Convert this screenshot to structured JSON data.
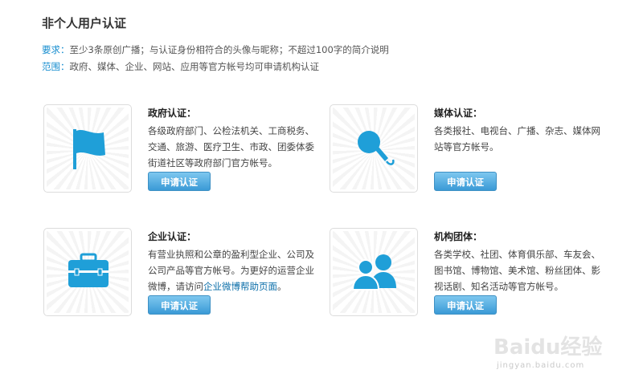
{
  "page": {
    "title": "非个人用户认证"
  },
  "requirements": {
    "req_label": "要求：",
    "req_text": "至少3条原创广播；与认证身份相符合的头像与昵称；不超过100字的简介说明",
    "scope_label": "范围：",
    "scope_text": "政府、媒体、企业、网站、应用等官方帐号均可申请机构认证"
  },
  "cards": {
    "gov": {
      "icon": "flag-icon",
      "title": "政府认证：",
      "desc": "各级政府部门、公检法机关、工商税务、交通、旅游、医疗卫生、市政、团委体委街道社区等政府部门官方帐号。",
      "button": "申请认证"
    },
    "media": {
      "icon": "microphone-icon",
      "title": "媒体认证：",
      "desc": "各类报社、电视台、广播、杂志、媒体网站等官方帐号。",
      "button": "申请认证"
    },
    "enterprise": {
      "icon": "briefcase-icon",
      "title": "企业认证：",
      "desc_pre": "有营业执照和公章的盈利型企业、公司及公司产品等官方帐号。为更好的运营企业微博，请访问",
      "desc_link": "企业微博帮助页面",
      "desc_post": "。",
      "button": "申请认证"
    },
    "org": {
      "icon": "group-icon",
      "title": "机构团体：",
      "desc": "各类学校、社团、体育俱乐部、车友会、图书馆、博物馆、美术馆、粉丝团体、影视话剧、知名活动等官方帐号。",
      "button": "申请认证"
    }
  },
  "watermark": {
    "text": "Baidu经验",
    "sub": "jingyan.baidu.com"
  },
  "colors": {
    "accent": "#1a8fd0",
    "icon": "#1f9fd8",
    "link": "#0c6fa9"
  }
}
